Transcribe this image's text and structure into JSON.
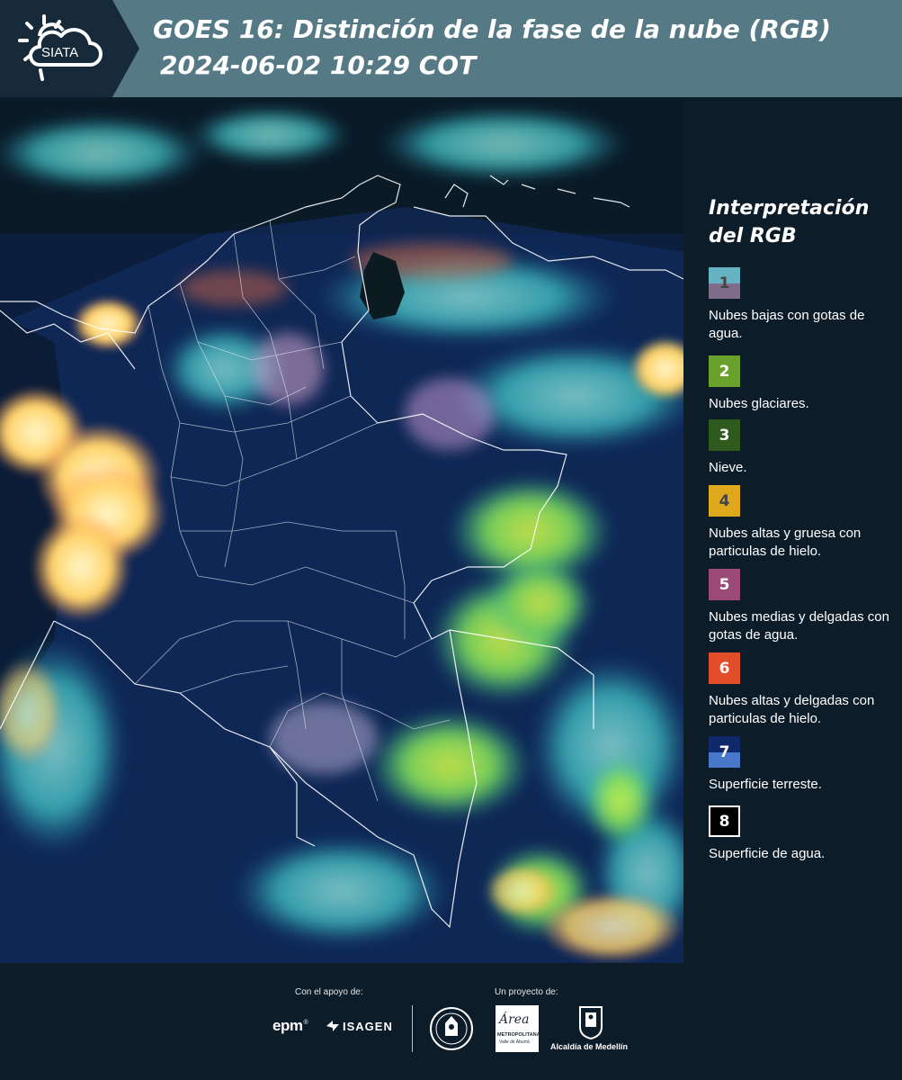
{
  "header": {
    "logo_text": "SIATA",
    "title_line1": "GOES 16: Distinción de la fase de la nube (RGB)",
    "title_line2": "2024-06-02 10:29 COT",
    "colors": {
      "bar": "#557a85",
      "logo_block": "#162a3a"
    }
  },
  "legend": {
    "title": "Interpretación del RGB",
    "items": [
      {
        "number": "1",
        "label": "Nubes bajas con gotas de agua.",
        "color_top": "#66b4c3",
        "color_bottom": "#7e6c8a",
        "number_color": "#444444"
      },
      {
        "number": "2",
        "label": "Nubes glaciares.",
        "color_top": "#6aa12d",
        "color_bottom": "#6aa12d",
        "number_color": "#ffffff"
      },
      {
        "number": "3",
        "label": "Nieve.",
        "color_top": "#2f5a1e",
        "color_bottom": "#2f5a1e",
        "number_color": "#ffffff"
      },
      {
        "number": "4",
        "label": "Nubes altas y gruesa con particulas de hielo.",
        "color_top": "#dfa81c",
        "color_bottom": "#dfa81c",
        "number_color": "#444444"
      },
      {
        "number": "5",
        "label": "Nubes medias y delgadas con gotas de agua.",
        "color_top": "#9b4a77",
        "color_bottom": "#9b4a77",
        "number_color": "#ffffff"
      },
      {
        "number": "6",
        "label": "Nubes altas y delgadas con particulas de hielo.",
        "color_top": "#e24e2a",
        "color_bottom": "#e24e2a",
        "number_color": "#ffffff"
      },
      {
        "number": "7",
        "label": "Superficie terreste.",
        "color_top": "#10296a",
        "color_bottom": "#4778c9",
        "number_color": "#ffffff"
      },
      {
        "number": "8",
        "label": "Superficie de agua.",
        "color_top": "#000000",
        "color_bottom": "#000000",
        "number_color": "#ffffff"
      }
    ]
  },
  "footer": {
    "support_label": "Con el apoyo de:",
    "project_label": "Un proyecto de:",
    "sponsors": [
      "epm",
      "ISAGEN"
    ],
    "partners": [
      "ÁREA METROPOLITANA Valle de Aburrá",
      "Alcaldía de Medellín"
    ],
    "epm_text": "epm",
    "isagen_text": "ISAGEN",
    "area_text": "Área",
    "area_subtext": "METROPOLITANA",
    "area_subtext2": "Valle de Aburrá",
    "alcaldia_text": "Alcaldía de Medellín"
  }
}
